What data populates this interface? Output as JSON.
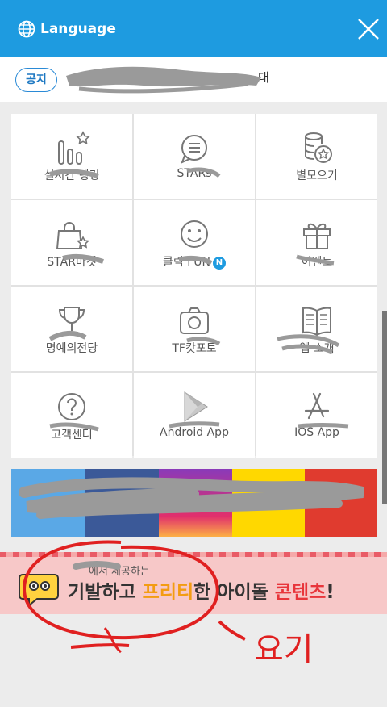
{
  "header": {
    "language_label": "Language"
  },
  "notice": {
    "badge": "공지",
    "text": "대"
  },
  "menu": [
    {
      "label": "실시간 랭킹",
      "icon": "bar-chart-star-icon"
    },
    {
      "label": "STARs",
      "icon": "chat-bubble-icon"
    },
    {
      "label": "별모으기",
      "icon": "coins-star-icon"
    },
    {
      "label": "STAR마켓",
      "icon": "shopping-bag-star-icon"
    },
    {
      "label": "클릭 FUN",
      "icon": "smiley-icon",
      "badge": "N"
    },
    {
      "label": "이벤트",
      "icon": "gift-icon"
    },
    {
      "label": "명예의전당",
      "icon": "trophy-icon"
    },
    {
      "label": "TF캇포토",
      "icon": "camera-icon"
    },
    {
      "label": "앱 소개",
      "icon": "book-icon"
    },
    {
      "label": "고객센터",
      "icon": "help-circle-icon"
    },
    {
      "label": "Android App",
      "icon": "play-store-icon"
    },
    {
      "label": "IOS App",
      "icon": "app-store-icon"
    }
  ],
  "social_colors": [
    "#4aa3e0",
    "#3b5998",
    "#8a3ab9",
    "#ffd800",
    "#e03b2f"
  ],
  "banner": {
    "small": "에서 제공하는",
    "big_1": "기발하고 ",
    "big_2": "프리티",
    "big_3": "한 아이돌 ",
    "big_4": "콘텐츠",
    "big_5": "!"
  },
  "annotation": {
    "text": "요기",
    "color": "#e02020"
  }
}
